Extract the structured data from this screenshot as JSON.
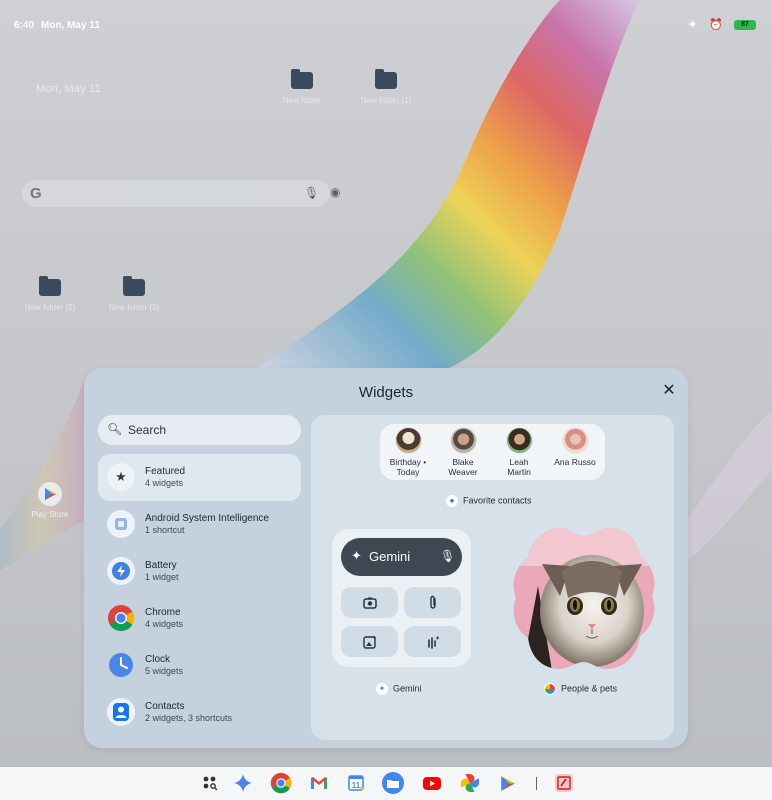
{
  "status_bar": {
    "time": "6:40",
    "date": "Mon, May 11",
    "battery": "87",
    "icons": [
      "gemini-sparkle-icon",
      "alarm-icon",
      "battery-icon"
    ]
  },
  "home": {
    "date": "Mon, May 11",
    "folders": [
      {
        "label": "New folder"
      },
      {
        "label": "New folder (1)"
      },
      {
        "label": "New folder (2)"
      },
      {
        "label": "New folder (3)"
      }
    ],
    "play_store_label": "Play Store"
  },
  "widgets_sheet": {
    "title": "Widgets",
    "search_placeholder": "Search",
    "categories": [
      {
        "name": "Featured",
        "sub": "4 widgets",
        "icon": "star-icon"
      },
      {
        "name": "Android System Intelligence",
        "sub": "1 shortcut",
        "icon": "asi-icon"
      },
      {
        "name": "Battery",
        "sub": "1 widget",
        "icon": "battery-bolt-icon"
      },
      {
        "name": "Chrome",
        "sub": "4 widgets",
        "icon": "chrome-icon"
      },
      {
        "name": "Clock",
        "sub": "5 widgets",
        "icon": "clock-icon"
      },
      {
        "name": "Contacts",
        "sub": "2 widgets, 3 shortcuts",
        "icon": "contacts-icon"
      }
    ],
    "favorite_contacts": {
      "contacts": [
        {
          "line1": "Birthday •",
          "line2": "Today"
        },
        {
          "line1": "Blake",
          "line2": "Weaver"
        },
        {
          "line1": "Leah",
          "line2": "Martin"
        },
        {
          "line1": "Ana Russo",
          "line2": ""
        }
      ],
      "label": "Favorite contacts"
    },
    "gemini_widget": {
      "bar_label": "Gemini",
      "label": "Gemini"
    },
    "people_pets_label": "People & pets"
  },
  "taskbar": {
    "apps": [
      "app-drawer-icon",
      "gemini-icon",
      "chrome-icon",
      "gmail-icon",
      "calendar-icon",
      "files-icon",
      "youtube-icon",
      "photos-icon",
      "play-store-icon",
      "recent-app-icon"
    ]
  },
  "colors": {
    "sheet_bg": "#c5d2dd",
    "preview_bg": "#d7e1e9",
    "accent_dark": "#3d4852",
    "battery_green": "#2fb84d"
  }
}
